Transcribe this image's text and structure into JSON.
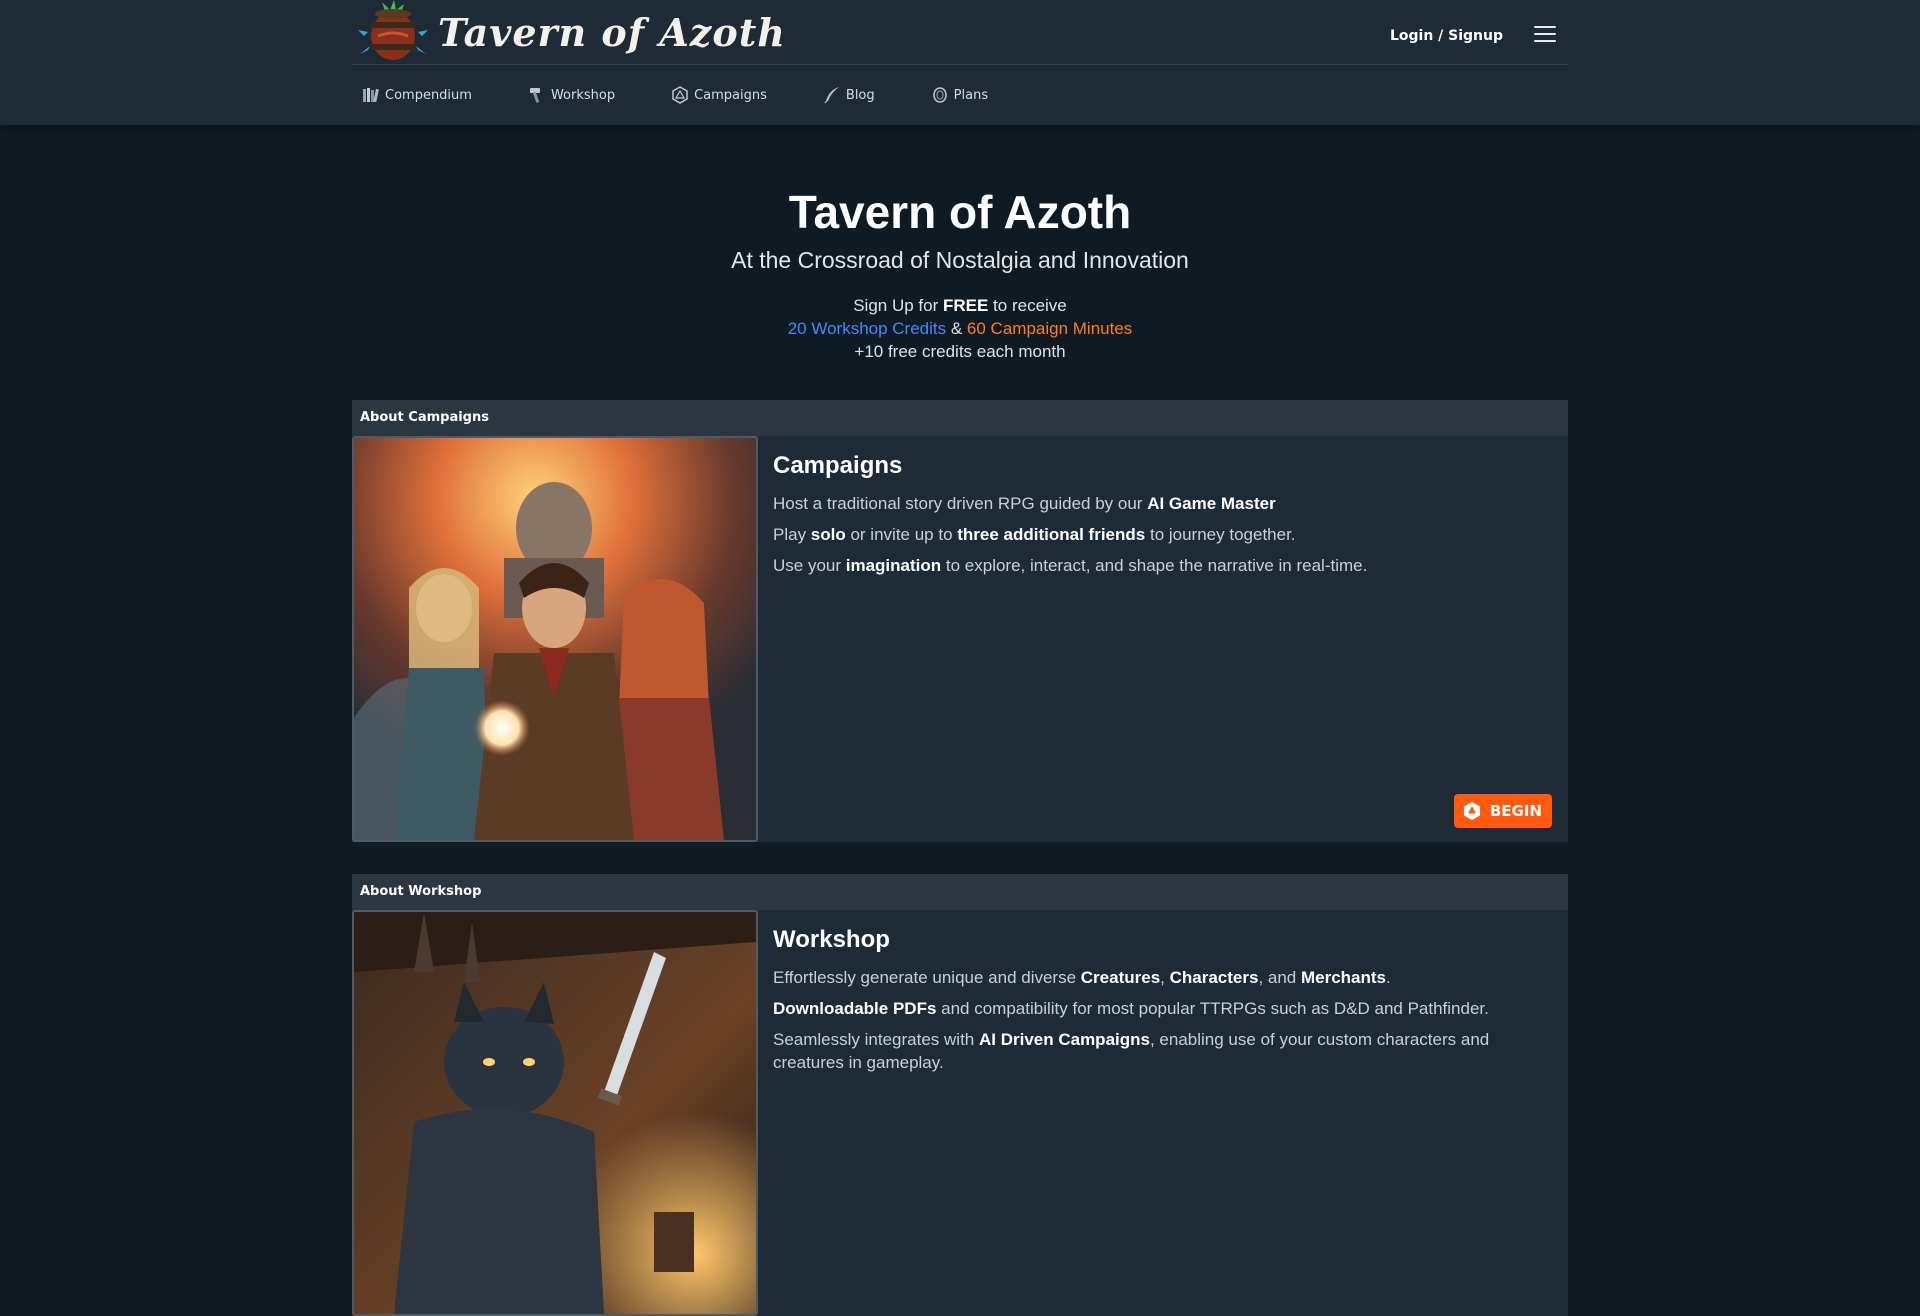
{
  "brand": {
    "name": "Tavern of Azoth"
  },
  "header": {
    "login_label": "Login / Signup"
  },
  "nav": {
    "items": [
      {
        "label": "Compendium",
        "icon": "books-icon"
      },
      {
        "label": "Workshop",
        "icon": "hammer-icon"
      },
      {
        "label": "Campaigns",
        "icon": "d20-icon"
      },
      {
        "label": "Blog",
        "icon": "quill-icon"
      },
      {
        "label": "Plans",
        "icon": "coins-icon"
      }
    ]
  },
  "hero": {
    "title": "Tavern of Azoth",
    "subtitle": "At the Crossroad of Nostalgia and Innovation",
    "signup_prefix": "Sign Up for ",
    "signup_free": "FREE",
    "signup_suffix": " to receive",
    "workshop_credits": "20 Workshop Credits",
    "amp": " & ",
    "campaign_minutes": "60 Campaign Minutes",
    "monthly": "+10 free credits each month"
  },
  "campaigns_card": {
    "header": "About Campaigns",
    "title": "Campaigns",
    "line1_a": "Host a traditional story driven RPG guided by our ",
    "line1_b": "AI Game Master",
    "line2_a": "Play ",
    "line2_b": "solo",
    "line2_c": " or invite up to ",
    "line2_d": "three additional friends",
    "line2_e": " to journey together.",
    "line3_a": "Use your ",
    "line3_b": "imagination",
    "line3_c": " to explore, interact, and shape the narrative in real-time.",
    "begin_label": "BEGIN"
  },
  "workshop_card": {
    "header": "About Workshop",
    "title": "Workshop",
    "line1_a": "Effortlessly generate unique and diverse ",
    "line1_b": "Creatures",
    "line1_c": ", ",
    "line1_d": "Characters",
    "line1_e": ", and ",
    "line1_f": "Merchants",
    "line1_g": ".",
    "line2_a": "Downloadable PDFs",
    "line2_b": " and compatibility for most popular TTRPGs such as D&D and Pathfinder.",
    "line3_a": "Seamlessly integrates with ",
    "line3_b": "AI Driven Campaigns",
    "line3_c": ", enabling use of your custom characters and creatures in gameplay."
  },
  "colors": {
    "accent_blue": "#3d8bff",
    "accent_orange": "#ff7d1a",
    "begin_button": "#ff5a10",
    "page_bg": "#0f1a23",
    "panel_bg": "#1e2a35"
  }
}
